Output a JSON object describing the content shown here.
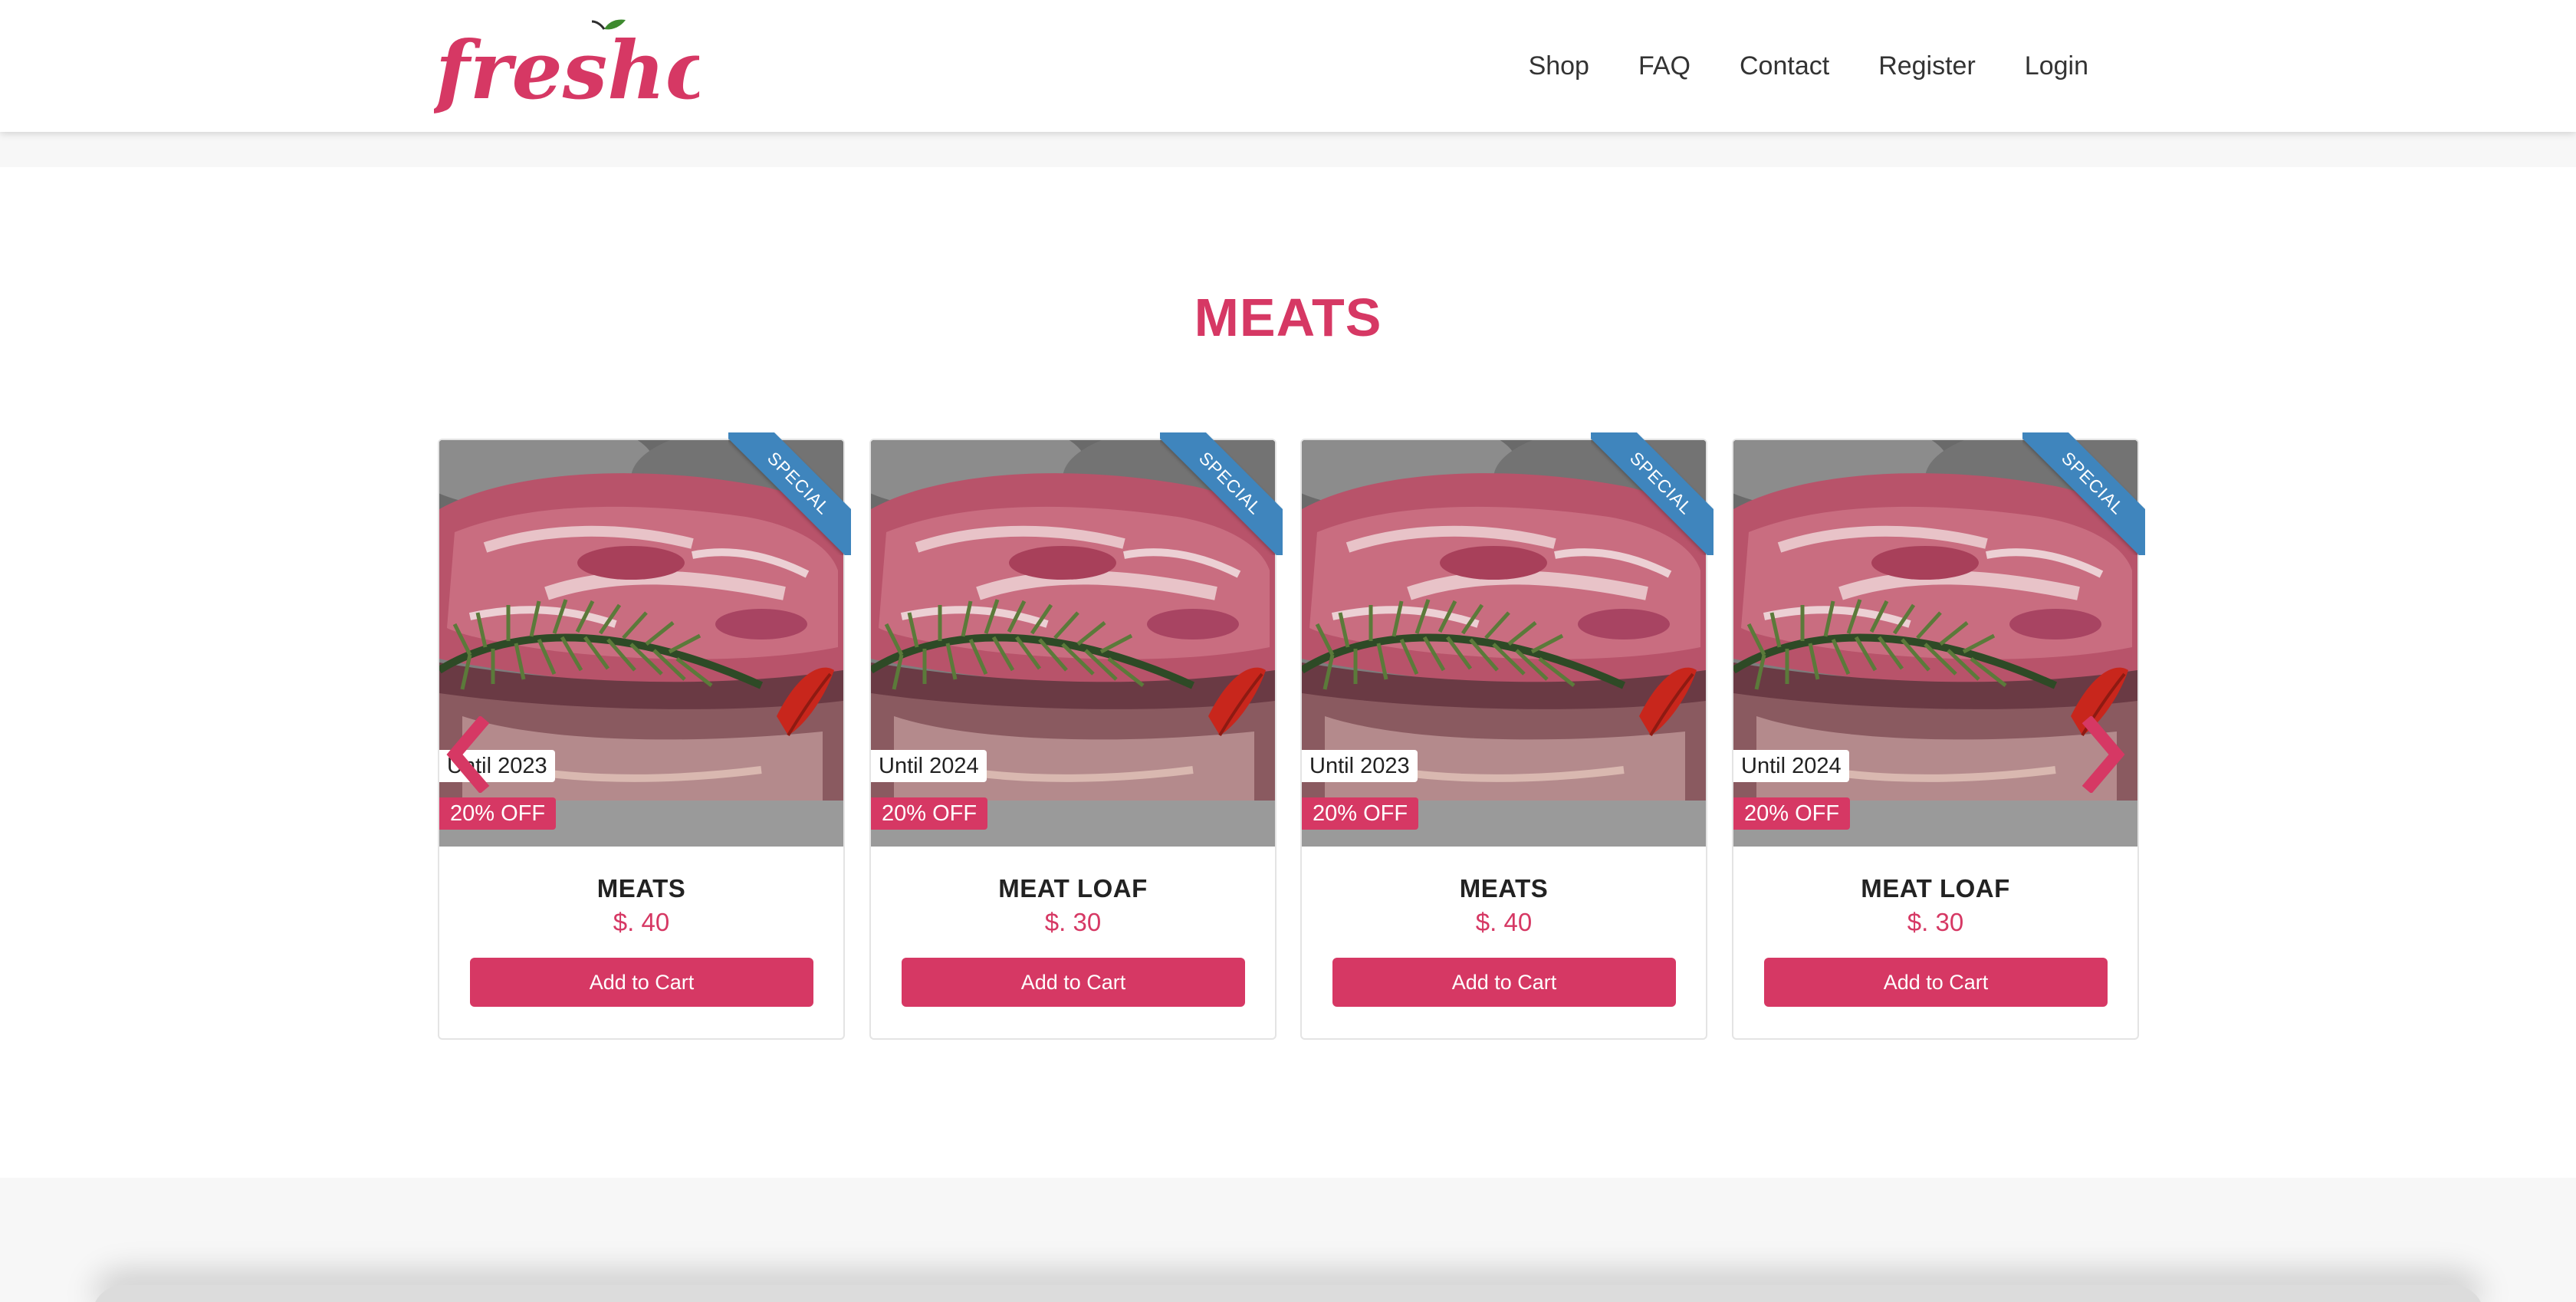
{
  "brand": {
    "logo_text": "freshcery",
    "accent_color": "#d63864"
  },
  "nav": {
    "items": [
      {
        "label": "Shop"
      },
      {
        "label": "FAQ"
      },
      {
        "label": "Contact"
      },
      {
        "label": "Register"
      },
      {
        "label": "Login"
      }
    ]
  },
  "section": {
    "title": "MEATS"
  },
  "carousel": {
    "prev_icon": "chevron-left-icon",
    "next_icon": "chevron-right-icon",
    "products": [
      {
        "name": "MEATS",
        "price": "$. 40",
        "until": "Until 2023",
        "discount": "20% OFF",
        "ribbon": "SPECIAL",
        "button": "Add to Cart"
      },
      {
        "name": "MEAT LOAF",
        "price": "$. 30",
        "until": "Until 2024",
        "discount": "20% OFF",
        "ribbon": "SPECIAL",
        "button": "Add to Cart"
      },
      {
        "name": "MEATS",
        "price": "$. 40",
        "until": "Until 2023",
        "discount": "20% OFF",
        "ribbon": "SPECIAL",
        "button": "Add to Cart"
      },
      {
        "name": "MEAT LOAF",
        "price": "$. 30",
        "until": "Until 2024",
        "discount": "20% OFF",
        "ribbon": "SPECIAL",
        "button": "Add to Cart"
      }
    ]
  },
  "colors": {
    "ribbon": "#3f85bd",
    "text_dark": "#222222",
    "footer_bg": "#f7f7f7"
  }
}
